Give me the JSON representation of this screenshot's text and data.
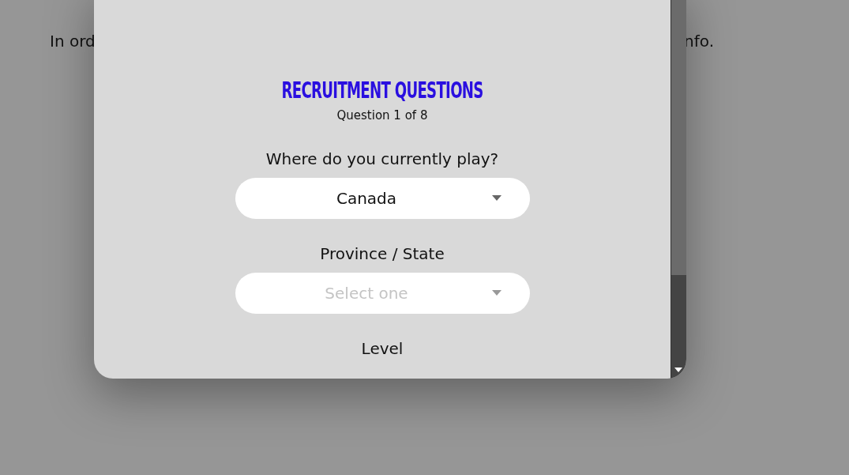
{
  "background": {
    "text_left": "In ord",
    "text_right": "nfo."
  },
  "dialog": {
    "title": "RECRUITMENT QUESTIONS",
    "progress": "Question 1 of 8",
    "fields": [
      {
        "label": "Where do you currently play?",
        "value": "Canada"
      },
      {
        "label": "Province / State",
        "placeholder": "Select one"
      },
      {
        "label": "Level"
      }
    ]
  }
}
